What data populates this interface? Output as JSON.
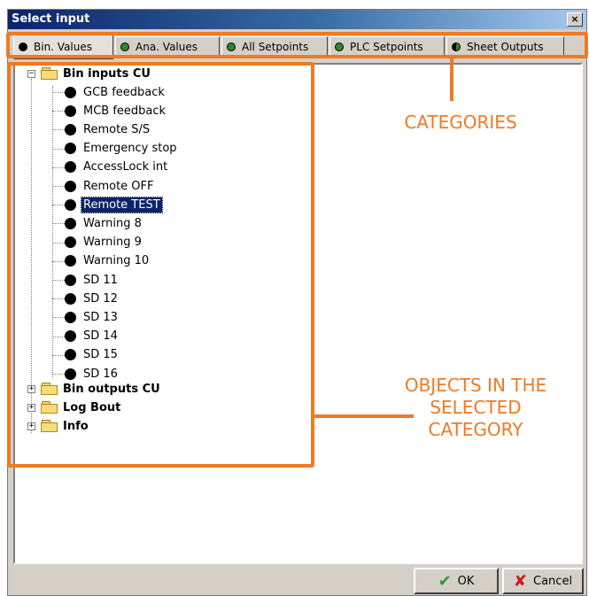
{
  "window": {
    "title": "Select input",
    "close_glyph": "×"
  },
  "tabs": [
    {
      "label": "Bin. Values",
      "dot_color": "#000000",
      "active": true
    },
    {
      "label": "Ana. Values",
      "dot_color": "#2a8a2a"
    },
    {
      "label": "All Setpoints",
      "dot_color": "#2a8a2a"
    },
    {
      "label": "PLC Setpoints",
      "dot_color": "#2a8a2a"
    },
    {
      "label": "Sheet Outputs",
      "dot_color": "half-black-green"
    }
  ],
  "tree": {
    "groups": [
      {
        "label": "Bin inputs CU",
        "expander": "−",
        "expanded": true,
        "items": [
          {
            "label": "GCB feedback"
          },
          {
            "label": "MCB feedback"
          },
          {
            "label": "Remote S/S"
          },
          {
            "label": "Emergency stop"
          },
          {
            "label": "AccessLock int"
          },
          {
            "label": "Remote OFF"
          },
          {
            "label": "Remote TEST",
            "selected": true
          },
          {
            "label": "Warning 8"
          },
          {
            "label": "Warning 9"
          },
          {
            "label": "Warning 10"
          },
          {
            "label": "SD 11"
          },
          {
            "label": "SD 12"
          },
          {
            "label": "SD 13"
          },
          {
            "label": "SD 14"
          },
          {
            "label": "SD 15"
          },
          {
            "label": "SD 16"
          }
        ]
      },
      {
        "label": "Bin outputs CU",
        "expander": "+"
      },
      {
        "label": "Log Bout",
        "expander": "+"
      },
      {
        "label": "Info",
        "expander": "+"
      }
    ]
  },
  "annotations": {
    "categories": "CATEGORIES",
    "objects": [
      "OBJECTS IN THE",
      "SELECTED",
      "CATEGORY"
    ],
    "color": "#f07a22"
  },
  "buttons": {
    "ok_label": "OK",
    "ok_icon": "checkmark-icon",
    "cancel_label": "Cancel",
    "cancel_icon": "cross-icon"
  }
}
